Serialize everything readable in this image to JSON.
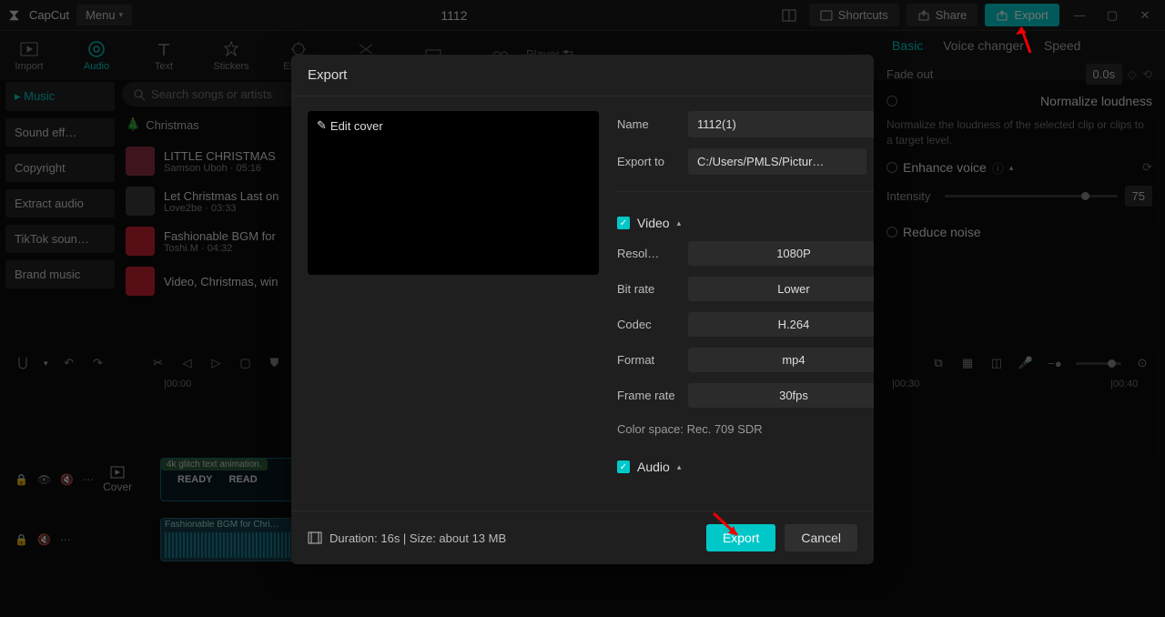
{
  "titlebar": {
    "app_name": "CapCut",
    "menu_label": "Menu",
    "project_title": "1112",
    "shortcuts": "Shortcuts",
    "share": "Share",
    "export": "Export"
  },
  "toolbar": {
    "import": "Import",
    "audio": "Audio",
    "text": "Text",
    "stickers": "Stickers",
    "effects": "Effects",
    "transitions": "Trans…"
  },
  "categories": {
    "music": "Music",
    "sound_effects": "Sound eff…",
    "copyright": "Copyright",
    "extract_audio": "Extract audio",
    "tiktok_sounds": "TikTok soun…",
    "brand_music": "Brand music"
  },
  "search": {
    "placeholder": "Search songs or artists"
  },
  "section_title": "Christmas",
  "songs": [
    {
      "title": "LITTLE CHRISTMAS",
      "artist": "Samson Uboh",
      "duration": "05:16"
    },
    {
      "title": "Let Christmas Last on",
      "artist": "Love2be",
      "duration": "03:33"
    },
    {
      "title": "Fashionable BGM for",
      "artist": "Toshi.M",
      "duration": "04:32"
    },
    {
      "title": "Video, Christmas, win",
      "artist": "",
      "duration": ""
    }
  ],
  "player_label": "Player",
  "right_tabs": {
    "basic": "Basic",
    "voice": "Voice changer",
    "speed": "Speed"
  },
  "right_panel": {
    "fade_out": "Fade out",
    "fade_out_val": "0.0s",
    "normalize": "Normalize loudness",
    "normalize_desc": "Normalize the loudness of the selected clip or clips to a target level.",
    "enhance": "Enhance voice",
    "intensity": "Intensity",
    "intensity_val": "75",
    "reduce": "Reduce noise"
  },
  "timeline": {
    "cover": "Cover",
    "marks": [
      "|00:00",
      "|00:30",
      "|00:40"
    ],
    "video_clip_tag": "4k glitch text animation.",
    "ready1": "READY",
    "ready2": "READ",
    "audio_clip": "Fashionable BGM for Chri…"
  },
  "modal": {
    "title": "Export",
    "edit_cover": "Edit cover",
    "name_label": "Name",
    "name_value": "1112(1)",
    "export_to_label": "Export to",
    "export_to_value": "C:/Users/PMLS/Pictur…",
    "video_section": "Video",
    "resolution_label": "Resol…",
    "resolution_value": "1080P",
    "bitrate_label": "Bit rate",
    "bitrate_value": "Lower",
    "codec_label": "Codec",
    "codec_value": "H.264",
    "format_label": "Format",
    "format_value": "mp4",
    "framerate_label": "Frame rate",
    "framerate_value": "30fps",
    "color_space": "Color space: Rec. 709 SDR",
    "audio_section": "Audio",
    "duration_info": "Duration: 16s | Size: about 13 MB",
    "export_btn": "Export",
    "cancel_btn": "Cancel"
  }
}
